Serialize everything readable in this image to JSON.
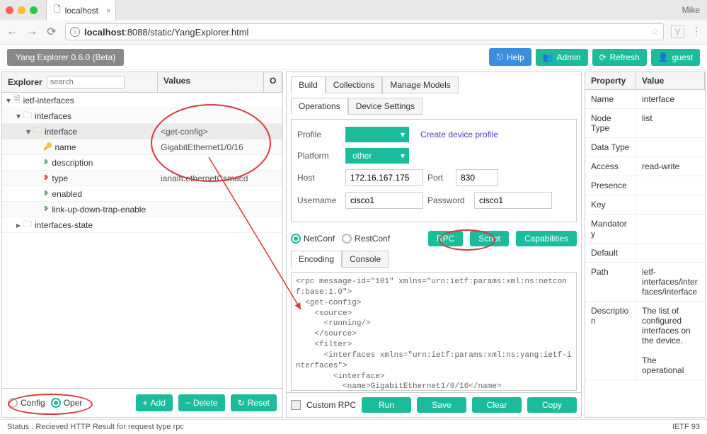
{
  "browser": {
    "tab_title": "localhost",
    "user": "Mike",
    "url_host": "localhost",
    "url_path": ":8088/static/YangExplorer.html"
  },
  "app": {
    "title": "Yang Explorer 0.6.0 (Beta)",
    "help": "Help",
    "admin": "Admin",
    "refresh": "Refresh",
    "guest": "guest"
  },
  "explorer": {
    "header": "Explorer",
    "search_placeholder": "search",
    "values_header": "Values",
    "o_header": "O",
    "tree": [
      {
        "indent": 0,
        "tw": "▾",
        "icon": "doc",
        "label": "ietf-interfaces",
        "value": ""
      },
      {
        "indent": 1,
        "tw": "▾",
        "icon": "folder",
        "label": "interfaces",
        "value": ""
      },
      {
        "indent": 2,
        "tw": "▾",
        "icon": "folder",
        "label": "interface",
        "value": "<get-config>",
        "sel": true
      },
      {
        "indent": 3,
        "tw": "",
        "icon": "key",
        "label": "name",
        "value": "GigabitEthernet1/0/16"
      },
      {
        "indent": 3,
        "tw": "",
        "icon": "leaf",
        "label": "description",
        "value": ""
      },
      {
        "indent": 3,
        "tw": "",
        "icon": "leaf-red",
        "label": "type",
        "value": "ianaift:ethernetCsmacd"
      },
      {
        "indent": 3,
        "tw": "",
        "icon": "leaf",
        "label": "enabled",
        "value": ""
      },
      {
        "indent": 3,
        "tw": "",
        "icon": "leaf",
        "label": "link-up-down-trap-enable",
        "value": ""
      },
      {
        "indent": 1,
        "tw": "▸",
        "icon": "folder",
        "label": "interfaces-state",
        "value": ""
      }
    ],
    "config": "Config",
    "oper": "Oper",
    "add": "Add",
    "delete": "Delete",
    "reset": "Reset"
  },
  "mid": {
    "tabs1": [
      "Build",
      "Collections",
      "Manage Models"
    ],
    "tabs2": [
      "Operations",
      "Device Settings"
    ],
    "profile_label": "Profile",
    "create_profile": "Create device profile",
    "platform_label": "Platform",
    "platform_value": "other",
    "host_label": "Host",
    "host_value": "172.16.167.175",
    "port_label": "Port",
    "port_value": "830",
    "username_label": "Username",
    "username_value": "cisco1",
    "password_label": "Password",
    "password_value": "cisco1",
    "netconf": "NetConf",
    "restconf": "RestConf",
    "rpc": "RPC",
    "script": "Script",
    "capabilities": "Capabilities",
    "tabs3": [
      "Encoding",
      "Console"
    ],
    "code": "<rpc message-id=\"101\" xmlns=\"urn:ietf:params:xml:ns:netconf:base:1.0\">\n  <get-config>\n    <source>\n      <running/>\n    </source>\n    <filter>\n      <interfaces xmlns=\"urn:ietf:params:xml:ns:yang:ietf-interfaces\">\n        <interface>\n          <name>GigabitEthernet1/0/16</name>\n          <type xmlns:ianaift=\"urn:ietf:params:xml:ns:yang:iana-if-type\">ianaift:ethernetCsmacd</type>\n        </interface>\n      </interfaces>",
    "custom_rpc": "Custom RPC",
    "run": "Run",
    "save": "Save",
    "clear": "Clear",
    "copy": "Copy"
  },
  "props": {
    "h1": "Property",
    "h2": "Value",
    "rows": [
      {
        "k": "Name",
        "v": "interface"
      },
      {
        "k": "Node Type",
        "v": "list"
      },
      {
        "k": "Data Type",
        "v": ""
      },
      {
        "k": "Access",
        "v": "read-write"
      },
      {
        "k": "Presence",
        "v": ""
      },
      {
        "k": "Key",
        "v": ""
      },
      {
        "k": "Mandatory",
        "v": ""
      },
      {
        "k": "Default",
        "v": ""
      },
      {
        "k": "Path",
        "v": "ietf-interfaces/interfaces/interface"
      },
      {
        "k": "Description",
        "v": "The list of configured interfaces on the device.\n\nThe operational"
      }
    ]
  },
  "status": {
    "text": "Status : Recieved HTTP Result for request type rpc",
    "right": "IETF 93"
  }
}
